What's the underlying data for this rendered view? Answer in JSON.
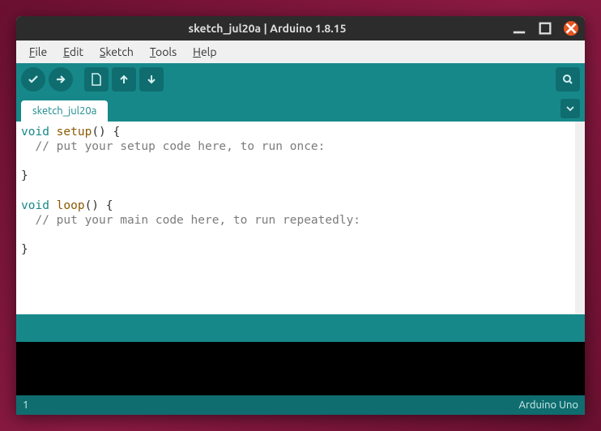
{
  "window": {
    "title": "sketch_jul20a | Arduino 1.8.15"
  },
  "menu": {
    "file": "File",
    "edit": "Edit",
    "sketch": "Sketch",
    "tools": "Tools",
    "help": "Help"
  },
  "tab": {
    "name": "sketch_jul20a"
  },
  "code": {
    "l1_kw": "void",
    "l1_fn": "setup",
    "l1_rest": "() {",
    "l2_cm": "  // put your setup code here, to run once:",
    "l3": "",
    "l4": "}",
    "l5": "",
    "l6_kw": "void",
    "l6_fn": "loop",
    "l6_rest": "() {",
    "l7_cm": "  // put your main code here, to run repeatedly:",
    "l8": "",
    "l9": "}"
  },
  "footer": {
    "line": "1",
    "board": "Arduino Uno"
  }
}
